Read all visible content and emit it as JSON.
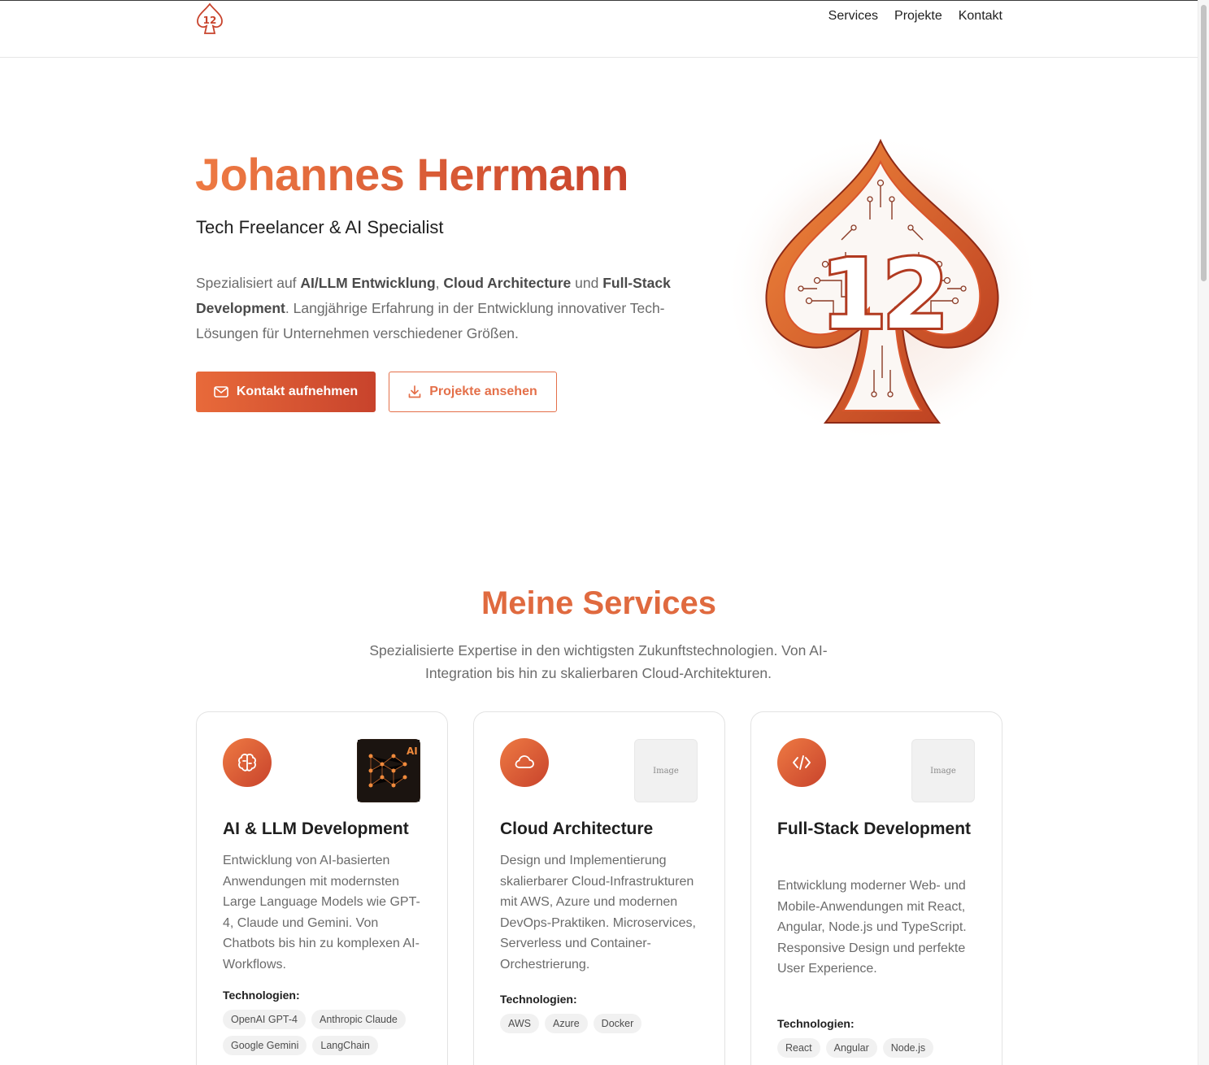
{
  "header": {
    "nav": [
      "Services",
      "Projekte",
      "Kontakt"
    ]
  },
  "hero": {
    "name": "Johannes Herrmann",
    "subtitle": "Tech Freelancer & AI Specialist",
    "desc": {
      "p1": "Spezialisiert auf ",
      "b1": "AI/LLM Entwicklung",
      "p2": ", ",
      "b2": "Cloud Architecture",
      "p3": " und ",
      "b3": "Full-Stack Development",
      "p4": ". Langjährige Erfahrung in der Entwicklung innovativer Tech-Lösungen für Unternehmen verschiedener Größen."
    },
    "primary_button": "Kontakt aufnehmen",
    "secondary_button": "Projekte ansehen",
    "art_number": "12"
  },
  "services": {
    "title": "Meine Services",
    "description": "Spezialisierte Expertise in den wichtigsten Zukunftstechnologien. Von AI-Integration bis hin zu skalierbaren Cloud-Architekturen.",
    "tech_label": "Technologien:",
    "cards": [
      {
        "icon": "brain-icon",
        "title": "AI & LLM Development",
        "thumb_label": "AI",
        "description": "Entwicklung von AI-basierten Anwendungen mit modernsten Large Language Models wie GPT-4, Claude und Gemini. Von Chatbots bis hin zu komplexen AI-Workflows.",
        "tags": [
          "OpenAI GPT-4",
          "Anthropic Claude",
          "Google Gemini",
          "LangChain"
        ]
      },
      {
        "icon": "cloud-icon",
        "title": "Cloud Architecture",
        "thumb_label": "Image",
        "description": "Design und Implementierung skalierbarer Cloud-Infrastrukturen mit AWS, Azure und modernen DevOps-Praktiken. Microservices, Serverless und Container-Orchestrierung.",
        "tags": [
          "AWS",
          "Azure",
          "Docker"
        ]
      },
      {
        "icon": "code-icon",
        "title": "Full-Stack Development",
        "thumb_label": "Image",
        "description": "Entwicklung moderner Web- und Mobile-Anwendungen mit React, Angular, Node.js und TypeScript. Responsive Design und perfekte User Experience.",
        "tags": [
          "React",
          "Angular",
          "Node.js"
        ]
      }
    ]
  },
  "colors": {
    "accent_start": "#ee7a43",
    "accent_end": "#c8432c"
  }
}
